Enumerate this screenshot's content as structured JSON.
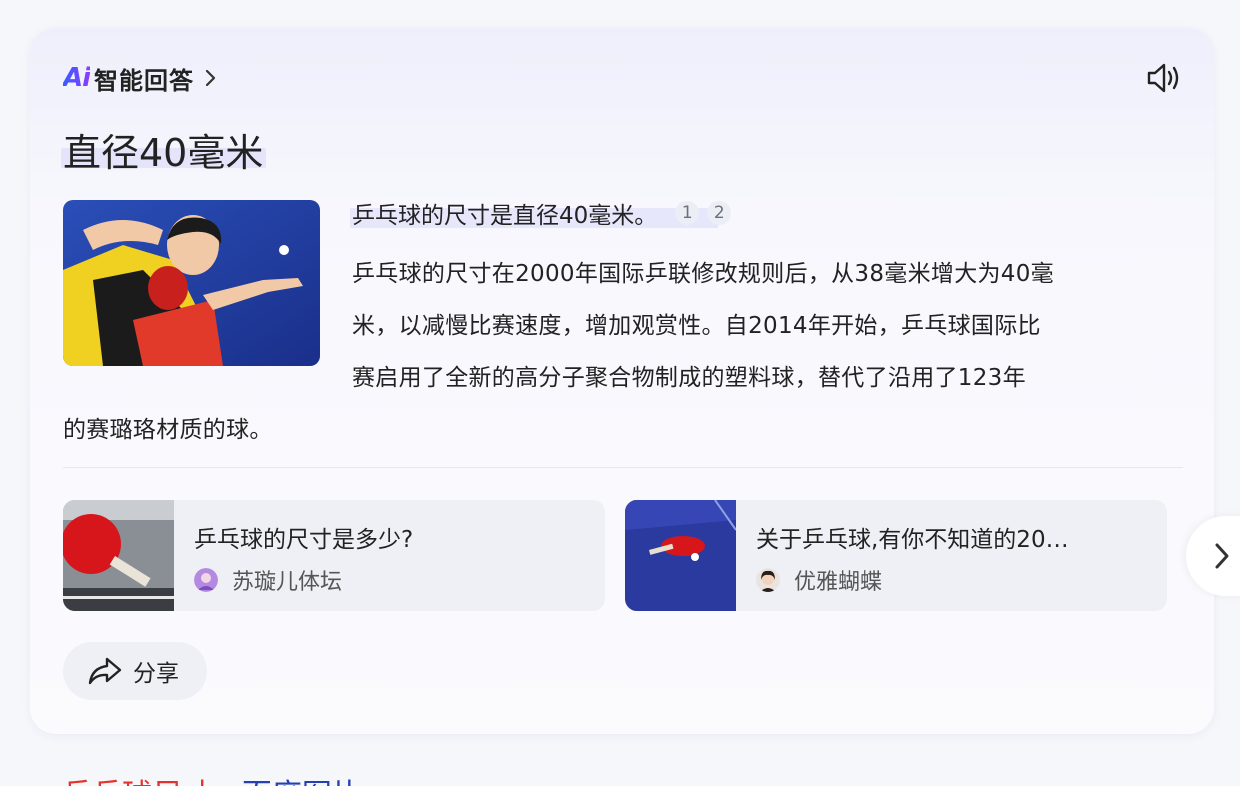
{
  "header": {
    "logo_text": "Ai",
    "title": "智能回答"
  },
  "answer": {
    "title": "直径40毫米",
    "summary": "乒乓球的尺寸是直径40毫米。",
    "citations": [
      "1",
      "2"
    ],
    "lines": [
      "乒乓球的尺寸在2000年国际乒联修改规则后，从38毫米增大为40毫",
      "米，以减慢比赛速度，增加观赏性。自2014年开始，乒乓球国际比",
      "赛启用了全新的高分子聚合物制成的塑料球，替代了沿用了123年",
      "的赛璐珞材质的球。"
    ]
  },
  "references": [
    {
      "title": "乒乓球的尺寸是多少?",
      "author": "苏璇儿体坛"
    },
    {
      "title": "关于乒乓球,有你不知道的20…",
      "author": "优雅蝴蝶"
    }
  ],
  "share": {
    "label": "分享"
  },
  "bottom_link": {
    "red": "乒乓球尺寸",
    "blue": " - 百度图片"
  },
  "colors": {
    "accent_start": "#3b5bff",
    "accent_end": "#8a3cff",
    "link_red": "#e5322d",
    "link_blue": "#2440b3"
  }
}
